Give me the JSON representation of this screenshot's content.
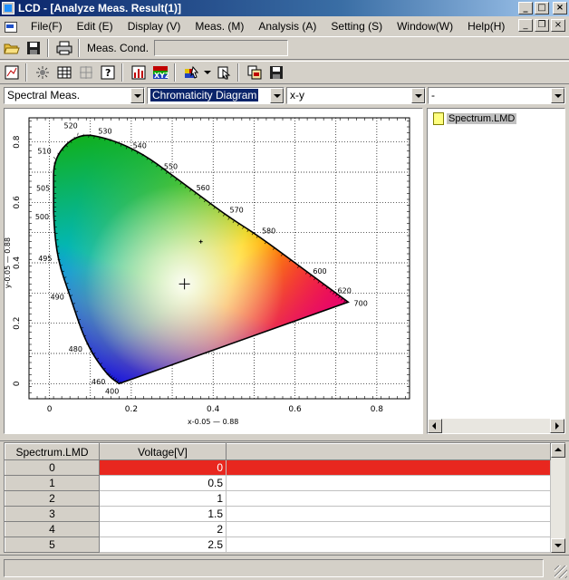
{
  "window": {
    "title": "LCD - [Analyze Meas. Result(1)]"
  },
  "menu": [
    {
      "label": "File(F)"
    },
    {
      "label": "Edit (E)"
    },
    {
      "label": "Display (V)"
    },
    {
      "label": "Meas. (M)"
    },
    {
      "label": "Analysis (A)"
    },
    {
      "label": "Setting (S)"
    },
    {
      "label": "Window(W)"
    },
    {
      "label": "Help(H)"
    }
  ],
  "toolbar": {
    "meas_cond_label": "Meas. Cond.",
    "meas_cond_value": ""
  },
  "combos": {
    "measurement": "Spectral Meas.",
    "view": "Chromaticity Diagram",
    "axes": "x-y",
    "extra": "-"
  },
  "chart_data": {
    "type": "scatter",
    "title": "",
    "xlabel": "x-0.05 — 0.88",
    "ylabel": "y-0.05 — 0.88",
    "xlim": [
      -0.05,
      0.88
    ],
    "ylim": [
      -0.05,
      0.88
    ],
    "x_ticks": [
      "0",
      "0.2",
      "0.4",
      "0.6",
      "0.8"
    ],
    "y_ticks": [
      "0",
      "0.2",
      "0.4",
      "0.6",
      "0.8"
    ],
    "grid": true,
    "locus_wavelength_labels": [
      {
        "nm": "400",
        "x": 0.17,
        "y": 0.0
      },
      {
        "nm": "460",
        "x": 0.14,
        "y": 0.03
      },
      {
        "nm": "480",
        "x": 0.09,
        "y": 0.13
      },
      {
        "nm": "490",
        "x": 0.05,
        "y": 0.29
      },
      {
        "nm": "495",
        "x": 0.02,
        "y": 0.41
      },
      {
        "nm": "500",
        "x": 0.01,
        "y": 0.54
      },
      {
        "nm": "505",
        "x": 0.01,
        "y": 0.63
      },
      {
        "nm": "510",
        "x": 0.01,
        "y": 0.75
      },
      {
        "nm": "520",
        "x": 0.07,
        "y": 0.83
      },
      {
        "nm": "530",
        "x": 0.15,
        "y": 0.81
      },
      {
        "nm": "540",
        "x": 0.23,
        "y": 0.76
      },
      {
        "nm": "550",
        "x": 0.3,
        "y": 0.69
      },
      {
        "nm": "560",
        "x": 0.37,
        "y": 0.62
      },
      {
        "nm": "570",
        "x": 0.44,
        "y": 0.55
      },
      {
        "nm": "580",
        "x": 0.51,
        "y": 0.49
      },
      {
        "nm": "600",
        "x": 0.63,
        "y": 0.37
      },
      {
        "nm": "620",
        "x": 0.69,
        "y": 0.31
      },
      {
        "nm": "700",
        "x": 0.73,
        "y": 0.27
      }
    ],
    "points": [
      {
        "name": "measured point",
        "x": 0.37,
        "y": 0.47
      },
      {
        "name": "white point",
        "x": 0.33,
        "y": 0.33
      }
    ]
  },
  "files": [
    {
      "label": "Spectrum.LMD"
    }
  ],
  "table": {
    "columns": [
      "Spectrum.LMD",
      "Voltage[V]"
    ],
    "rows": [
      {
        "index": "0",
        "voltage": "0"
      },
      {
        "index": "1",
        "voltage": "0.5"
      },
      {
        "index": "2",
        "voltage": "1"
      },
      {
        "index": "3",
        "voltage": "1.5"
      },
      {
        "index": "4",
        "voltage": "2"
      },
      {
        "index": "5",
        "voltage": "2.5"
      }
    ]
  },
  "colors": {
    "selected_row": "#e8271f",
    "title_bar": "#0a246a"
  }
}
